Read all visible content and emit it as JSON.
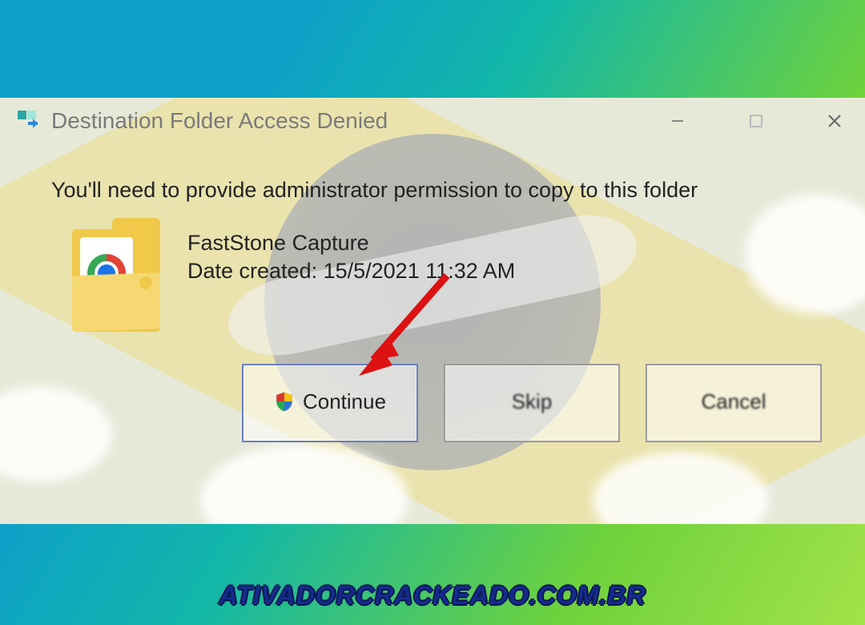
{
  "dialog": {
    "title": "Destination Folder Access Denied",
    "message": "You'll need to provide administrator permission to copy to this folder",
    "folder": {
      "name": "FastStone Capture",
      "date_label": "Date created: 15/5/2021 11:32 AM"
    },
    "buttons": {
      "continue": {
        "label": "Continue",
        "sub": ""
      },
      "skip": {
        "label": "Skip",
        "sub": ""
      },
      "cancel": {
        "label": "Cancel",
        "sub": ""
      }
    },
    "controls": {
      "minimize": "minimize",
      "maximize": "maximize",
      "close": "close"
    }
  },
  "watermark": "ATIVADORCRACKEADO.COM.BR",
  "icons": {
    "app": "copy-move-icon",
    "folder": "folder-chrome-icon",
    "shield": "uac-shield-icon"
  },
  "annotation": {
    "arrow_target": "continue-button"
  }
}
